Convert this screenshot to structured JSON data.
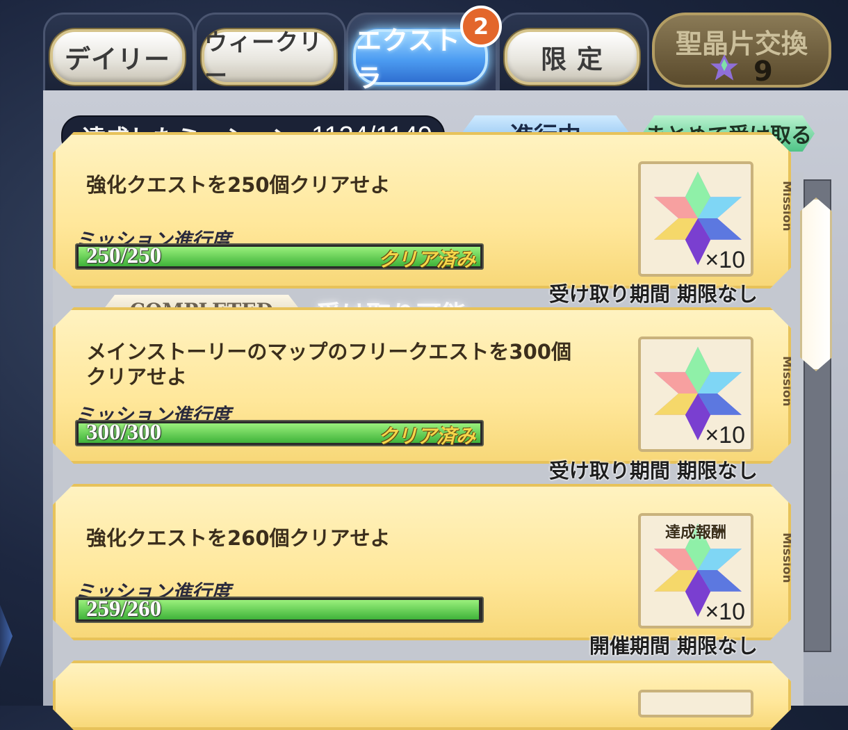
{
  "tabs": [
    {
      "label": "デイリー",
      "active": false
    },
    {
      "label": "ウィークリー",
      "active": false
    },
    {
      "label": "エクストラ",
      "active": true
    },
    {
      "label": "限 定",
      "active": false
    }
  ],
  "badge_count": "2",
  "exchange": {
    "label": "聖晶片交換",
    "count": "9"
  },
  "summary": {
    "label": "達成したミッション",
    "value": "1124/1149"
  },
  "filter_button": "進行中",
  "collect_all_button": "まとめて受け取る",
  "completed_banner": "-COMPLETED-",
  "receivable_text": "受け取り可能",
  "missions": [
    {
      "text": "強化クエストを250個クリアせよ",
      "progress_label": "ミッション進行度",
      "progress": "250/250",
      "progress_fraction": 1.0,
      "cleared_label": "クリア済み",
      "reward_tag": "",
      "reward_qty": "×10",
      "mission_tag": "Mission",
      "period": "受け取り期間 期限なし"
    },
    {
      "text": "メインストーリーのマップのフリークエストを300個クリアせよ",
      "progress_label": "ミッション進行度",
      "progress": "300/300",
      "progress_fraction": 1.0,
      "cleared_label": "クリア済み",
      "reward_tag": "",
      "reward_qty": "×10",
      "mission_tag": "Mission",
      "period": "受け取り期間 期限なし"
    },
    {
      "text": "強化クエストを260個クリアせよ",
      "progress_label": "ミッション進行度",
      "progress": "259/260",
      "progress_fraction": 0.996,
      "cleared_label": "",
      "reward_tag": "達成報酬",
      "reward_qty": "×10",
      "mission_tag": "Mission",
      "period": "開催期間 期限なし"
    }
  ],
  "colors": {
    "accent_blue": "#4d9df2",
    "card_gold": "#ffe79a",
    "bar_green": "#3fb33a",
    "badge_orange": "#e3662b"
  },
  "icons": {
    "reward": "saint-quartz-icon",
    "exchange": "saint-quartz-fragment-icon"
  }
}
